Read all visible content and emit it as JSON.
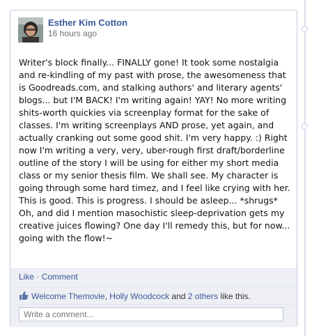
{
  "post": {
    "author": "Esther Kim Cotton",
    "timestamp": "16 hours ago",
    "body": "Writer's block finally... FINALLY gone! It took some nostalgia and re-kindling of my past with prose, the awesomeness that is Goodreads.com, and stalking authors' and literary agents' blogs... but I'M BACK! I'm writing again! YAY! No more writing shits-worth quickies via screenplay format for the sake of classes. I'm writing screenplays AND prose, yet again, and actually cranking out some good shit. I'm very happy. :) Right now I'm writing a very, very, uber-rough first draft/borderline outline of the story I will be using for either my short media class or my senior thesis film. We shall see. My character is going through some hard timez, and I feel like crying with her. This is good. This is progress. I should be asleep... *shrugs* Oh, and did I mention masochistic sleep-deprivation gets my creative juices flowing? One day I'll remedy this, but for now... going with the flow!~"
  },
  "actions": {
    "like": "Like",
    "separator": " · ",
    "comment": "Comment"
  },
  "likes": {
    "person1": "Welcome Themovie",
    "sep": ", ",
    "person2": "Holly Woodcock",
    "and": " and ",
    "others": "2 others",
    "suffix": " like this."
  },
  "comment_input": {
    "placeholder": "Write a comment..."
  },
  "colors": {
    "link": "#3b5998",
    "footer_bg": "#edeff4"
  },
  "icons": {
    "like": "thumbs-up-icon"
  }
}
